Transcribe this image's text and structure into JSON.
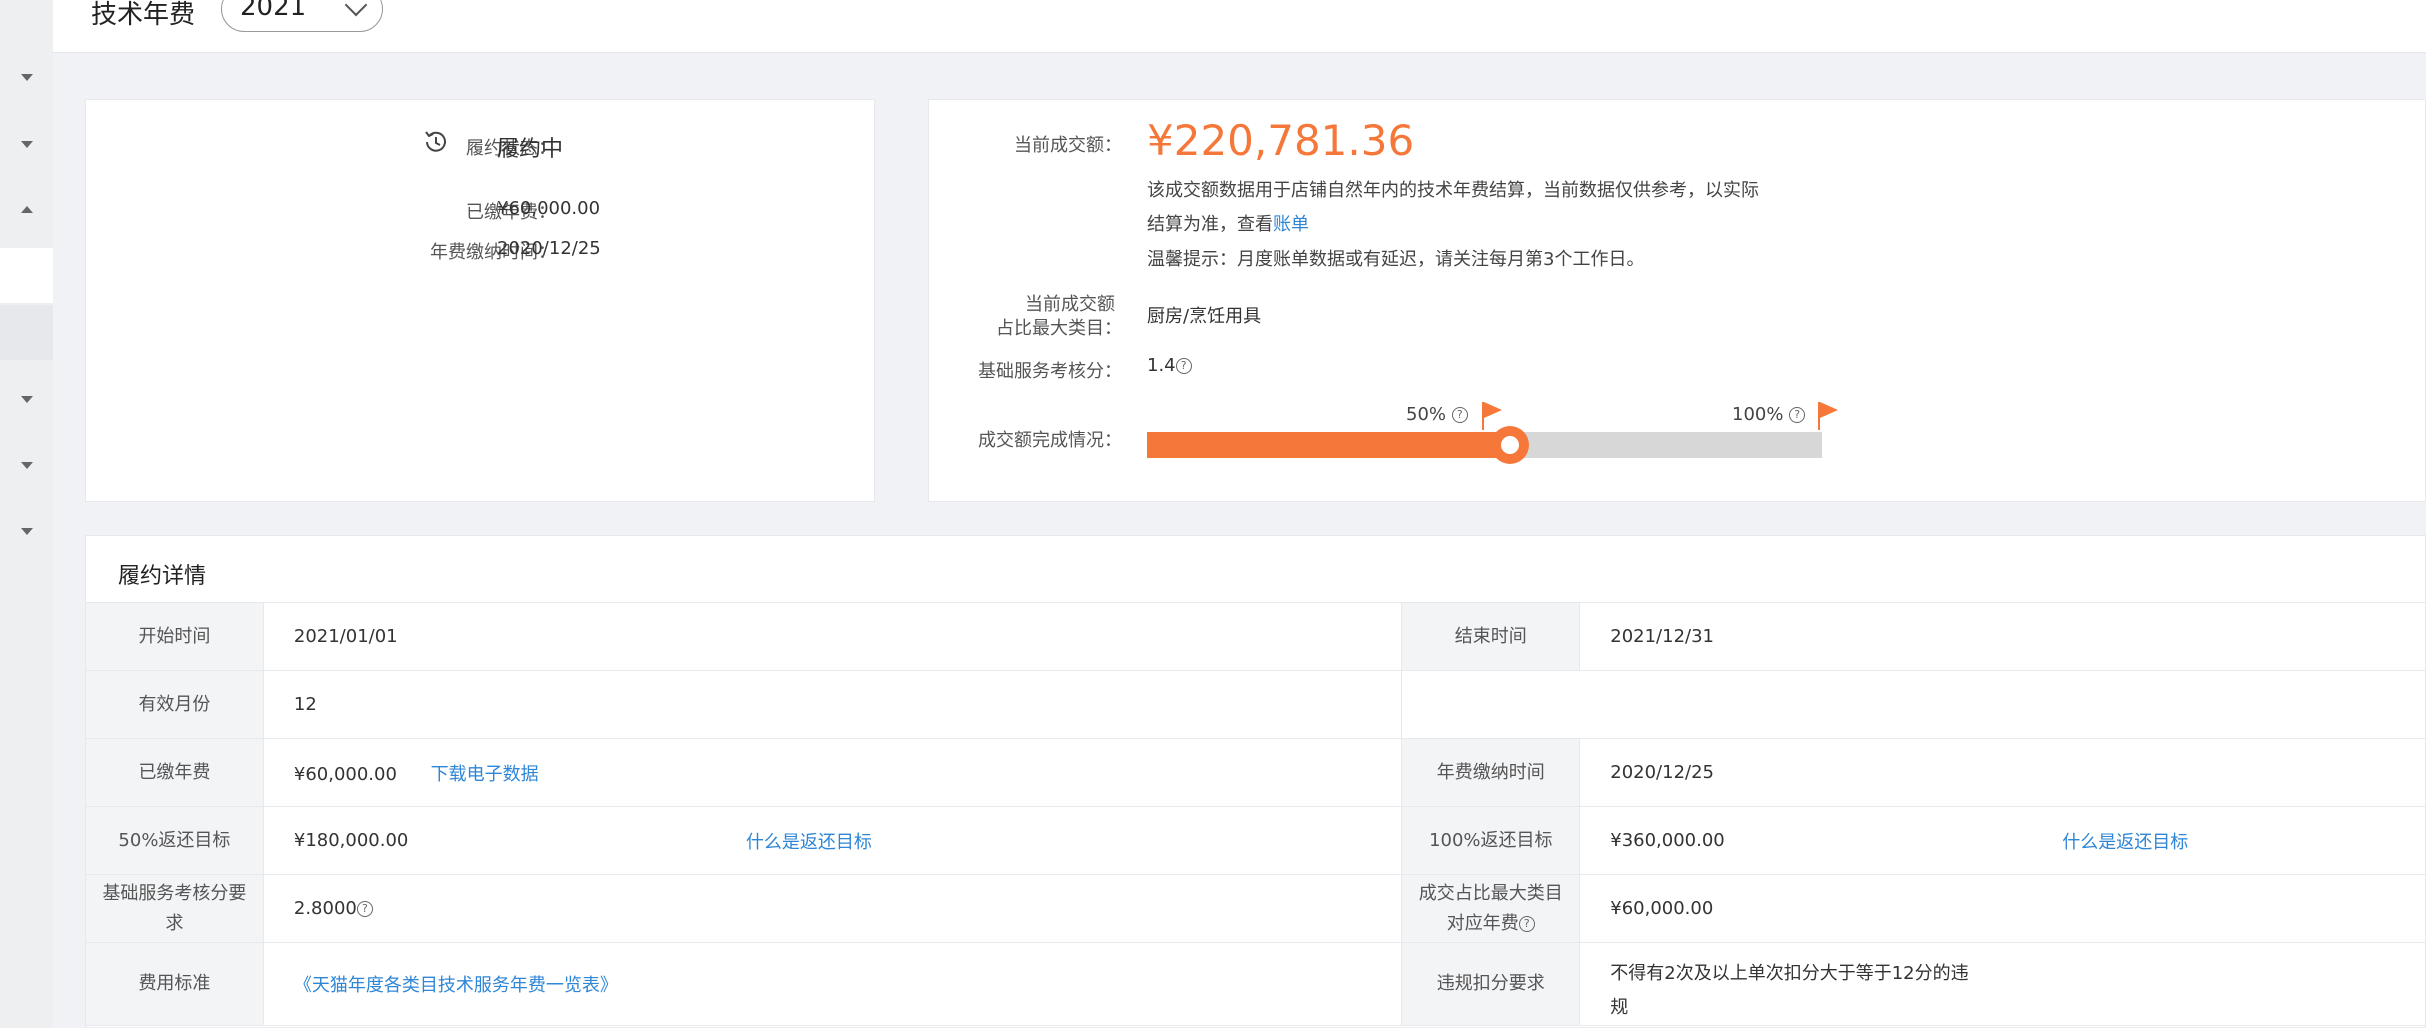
{
  "header": {
    "title": "技术年费",
    "year": "2021"
  },
  "status_card": {
    "status_label": "履约状态：",
    "status_value": "履约中",
    "paid_label": "已缴年费：",
    "paid_value": "¥60,000.00",
    "paid_time_label": "年费缴纳时间：",
    "paid_time_value": "2020/12/25"
  },
  "deal_card": {
    "current_label": "当前成交额：",
    "current_value": "¥220,781.36",
    "note_line1": "该成交额数据用于店铺自然年内的技术年费结算，当前数据仅供参考，以实际",
    "note_line2_prefix": "结算为准，查看",
    "note_line2_link": "账单",
    "note_line3": "温馨提示：月度账单数据或有延迟，请关注每月第3个工作日。",
    "top_category_label_1": "当前成交额",
    "top_category_label_2": "占比最大类目：",
    "top_category_value": "厨房/烹饪用具",
    "score_label": "基础服务考核分：",
    "score_value": "1.4",
    "progress_label": "成交额完成情况：",
    "milestone_50": "50%",
    "milestone_100": "100%",
    "progress_fraction": 0.5383
  },
  "detail": {
    "title": "履约详情",
    "start_label": "开始时间",
    "start_value": "2021/01/01",
    "end_label": "结束时间",
    "end_value": "2021/12/31",
    "months_label": "有效月份",
    "months_value": "12",
    "paid_label": "已缴年费",
    "paid_value": "¥60,000.00",
    "download_link": "下载电子数据",
    "paid_time_label": "年费缴纳时间",
    "paid_time_value": "2020/12/25",
    "target50_label": "50%返还目标",
    "target50_value": "¥180,000.00",
    "what_target_link": "什么是返还目标",
    "target100_label": "100%返还目标",
    "target100_value": "¥360,000.00",
    "what_target_link2": "什么是返还目标",
    "score_req_label_1": "基础服务考核分要",
    "score_req_label_2": "求",
    "score_req_value": "2.8000",
    "top_fee_label_1": "成交占比最大类目",
    "top_fee_label_2": "对应年费",
    "top_fee_value": "¥60,000.00",
    "fee_std_label": "费用标准",
    "fee_std_link": "《天猫年度各类目技术服务年费一览表》",
    "violation_label": "违规扣分要求",
    "violation_value_1": "不得有2次及以上单次扣分大于等于12分的违",
    "violation_value_2": "规"
  },
  "icons": {
    "question": "?",
    "history": "history-icon",
    "accent": "#f5783a",
    "link": "#2f86d6"
  }
}
